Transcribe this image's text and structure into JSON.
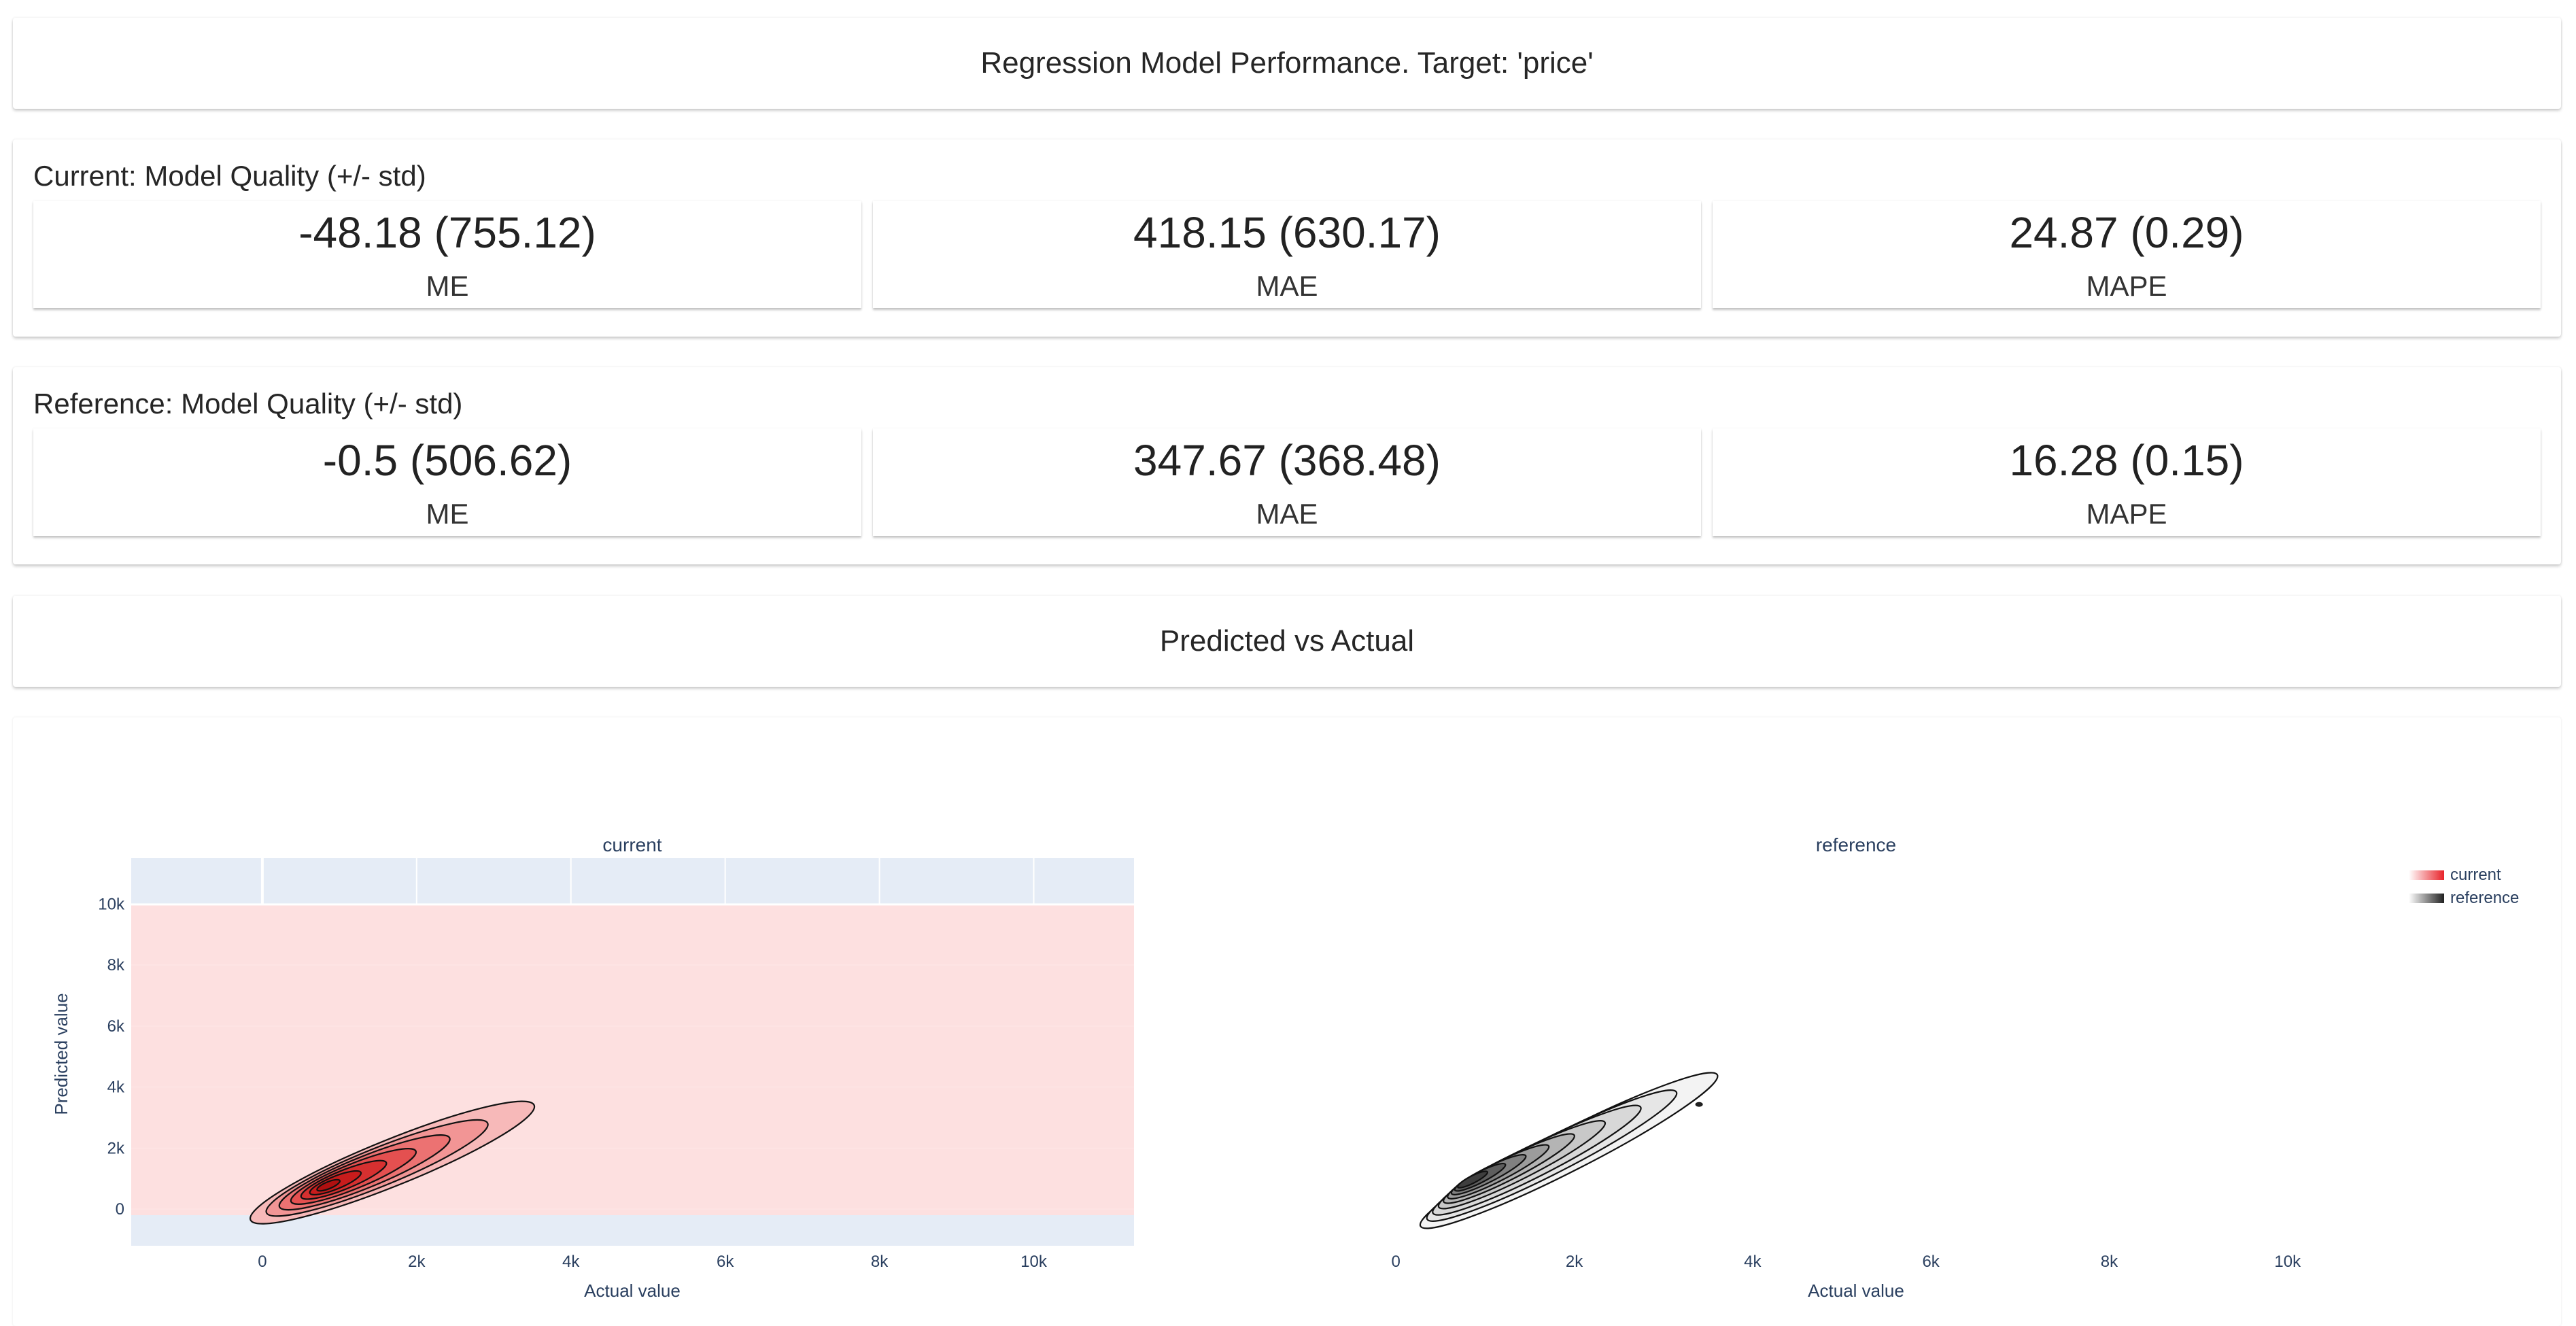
{
  "header": {
    "title": "Regression Model Performance. Target: 'price'"
  },
  "current_quality": {
    "title": "Current: Model Quality (+/- std)",
    "metrics": [
      {
        "value": "-48.18 (755.12)",
        "label": "ME"
      },
      {
        "value": "418.15 (630.17)",
        "label": "MAE"
      },
      {
        "value": "24.87 (0.29)",
        "label": "MAPE"
      }
    ]
  },
  "reference_quality": {
    "title": "Reference: Model Quality (+/- std)",
    "metrics": [
      {
        "value": "-0.5 (506.62)",
        "label": "ME"
      },
      {
        "value": "347.67 (368.48)",
        "label": "MAE"
      },
      {
        "value": "16.28 (0.15)",
        "label": "MAPE"
      }
    ]
  },
  "section": {
    "title": "Predicted vs Actual"
  },
  "chart_data": {
    "type": "contour",
    "subplots": [
      {
        "title": "current",
        "xlabel": "Actual value",
        "ylabel": "Predicted value",
        "x_ticks": [
          "0",
          "2k",
          "4k",
          "6k",
          "8k",
          "10k"
        ],
        "y_ticks": [
          "0",
          "2k",
          "4k",
          "6k",
          "8k",
          "10k"
        ],
        "xlim": [
          -1700,
          11300
        ],
        "ylim": [
          -1200,
          11500
        ],
        "colorscale": "reds",
        "density_center": {
          "x": 1100,
          "y": 1000
        },
        "outer_extent": {
          "x": [
            -900,
            3500
          ],
          "y": [
            0,
            3300
          ]
        }
      },
      {
        "title": "reference",
        "xlabel": "Actual value",
        "ylabel": "",
        "x_ticks": [
          "0",
          "2k",
          "4k",
          "6k",
          "8k",
          "10k"
        ],
        "xlim": [
          -200,
          11100
        ],
        "colorscale": "greys",
        "density_center": {
          "x": 1100,
          "y": 1000
        },
        "outer_extent": {
          "x": [
            -200,
            4100
          ],
          "y": [
            0,
            4100
          ]
        }
      }
    ],
    "legend": {
      "position": "top-right",
      "entries": [
        {
          "name": "current",
          "color": "#e8232a"
        },
        {
          "name": "reference",
          "color": "#555555"
        }
      ]
    },
    "colors": {
      "plot_bg": "#e5ecf6",
      "current_fill": "#fde0e0",
      "axis_text": "#2a3f5f"
    }
  }
}
